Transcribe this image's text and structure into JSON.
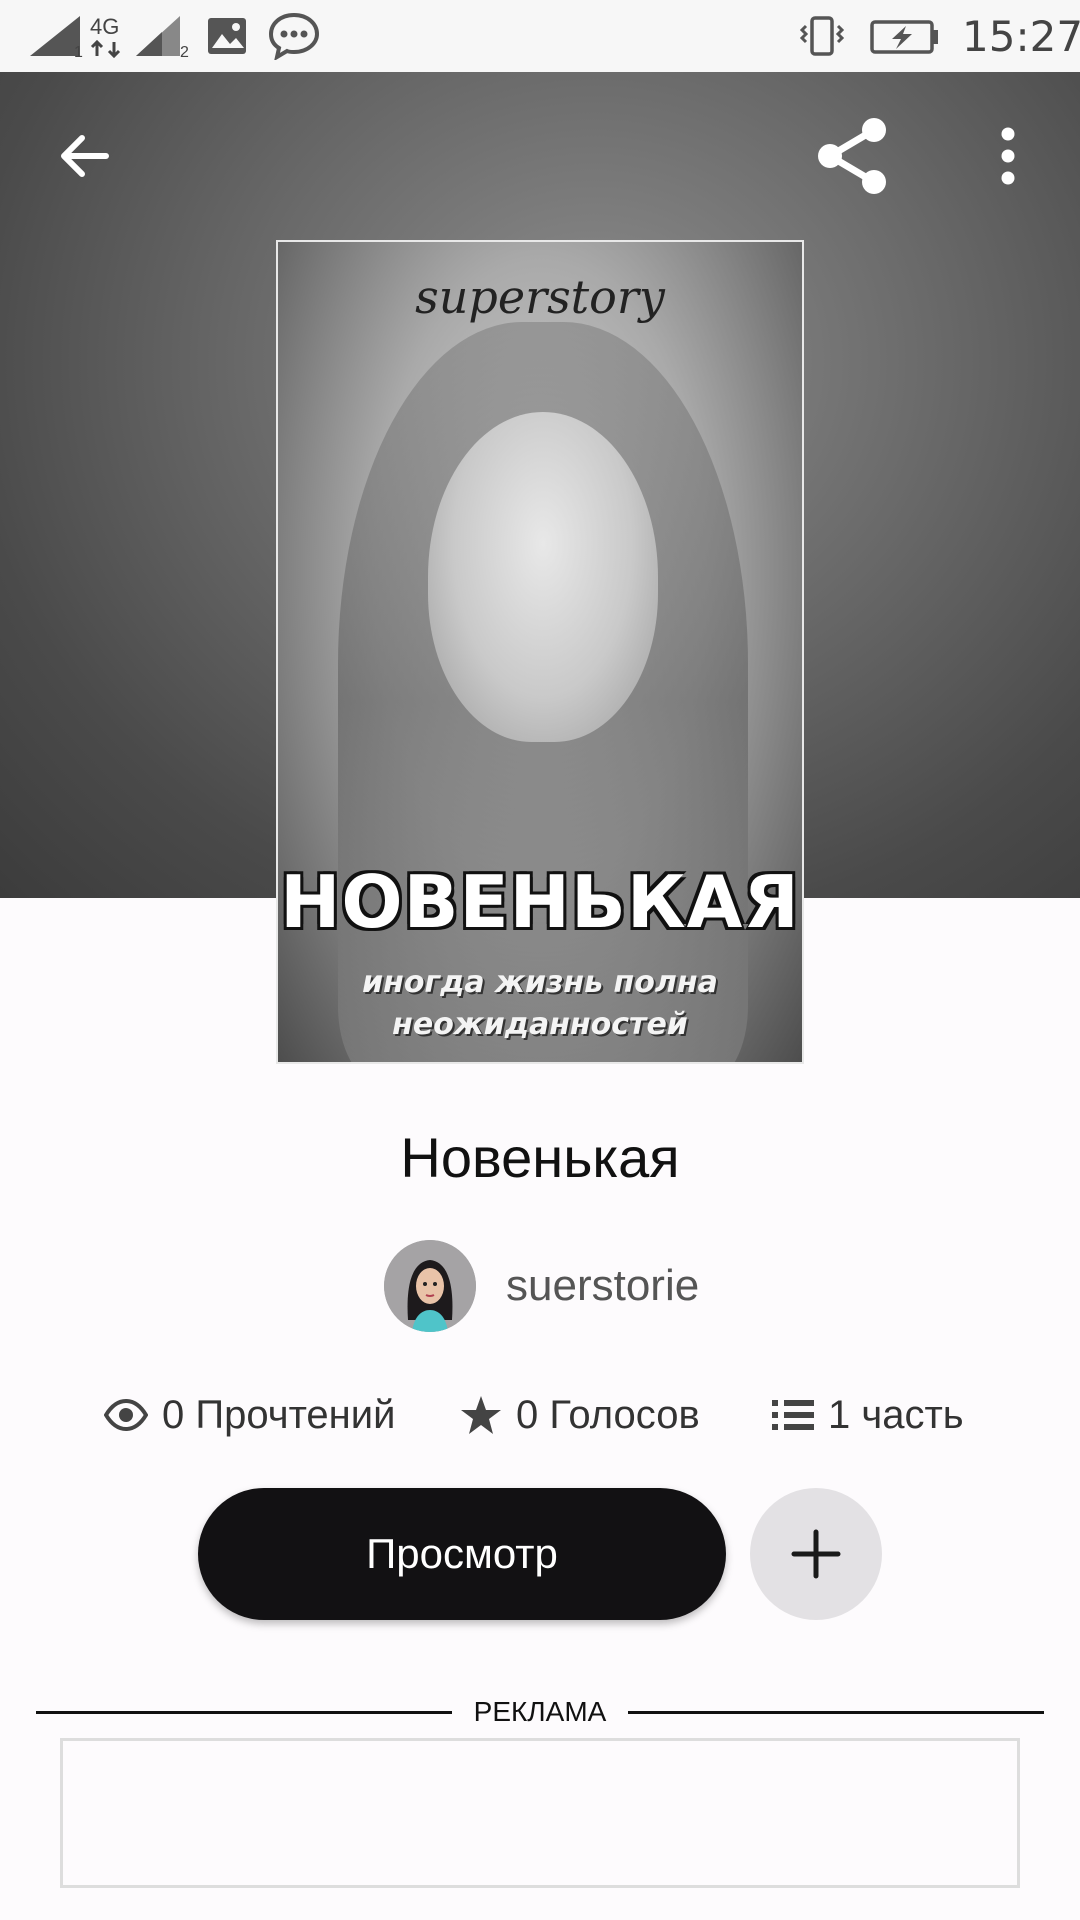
{
  "status_bar": {
    "network": "4G",
    "sim1": "1",
    "sim2": "2",
    "time": "15:27"
  },
  "toolbar": {
    "back_icon": "arrow-back-icon",
    "share_icon": "share-icon",
    "menu_icon": "more-vert-icon"
  },
  "cover": {
    "brand": "superstory",
    "title": "НОВЕНЬКАЯ",
    "subtitle_line1": "иногда жизнь полна",
    "subtitle_line2": "неожиданностей"
  },
  "story": {
    "title": "Новенькая",
    "author": "suerstorie"
  },
  "stats": {
    "reads": "0 Прочтений",
    "votes": "0 Голосов",
    "parts": "1 часть"
  },
  "actions": {
    "read_label": "Просмотр",
    "add_icon": "plus-icon"
  },
  "ads": {
    "label": "РЕКЛАМА"
  },
  "colors": {
    "header_bg": "#5a5a5a",
    "primary_button": "#121113",
    "secondary_button": "#e3e1e4",
    "page_bg": "#fdfbfd"
  }
}
